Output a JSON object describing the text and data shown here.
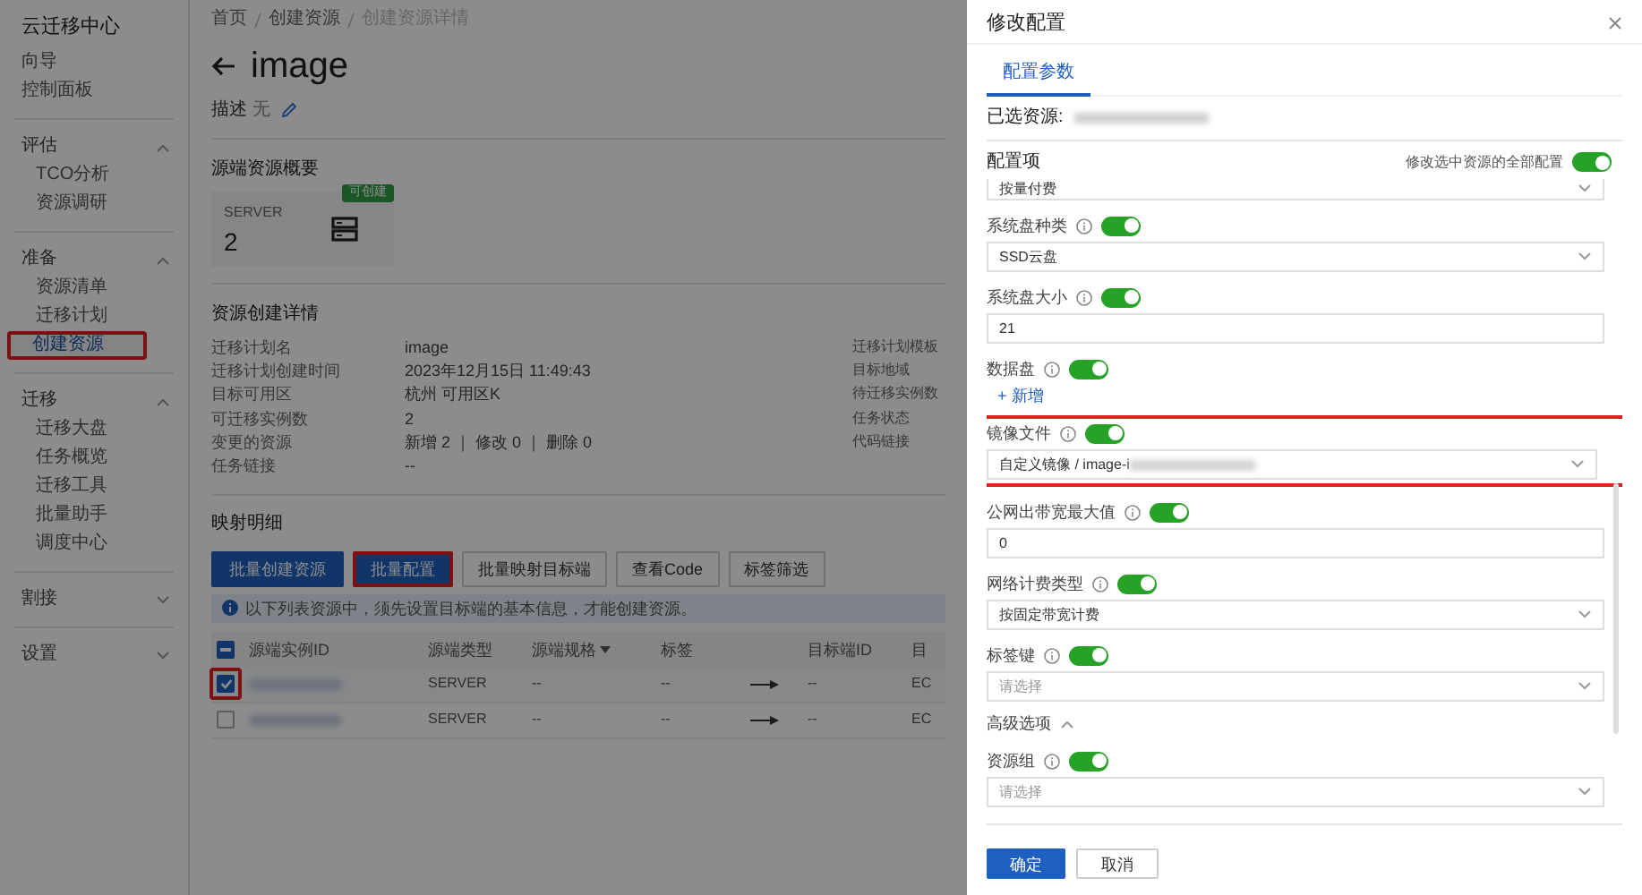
{
  "sidebar": {
    "title": "云迁移中心",
    "groups": [
      {
        "kind": "links",
        "items": [
          {
            "label": "向导",
            "selected": false,
            "highlighted": false
          },
          {
            "label": "控制面板",
            "selected": false,
            "highlighted": false
          }
        ]
      },
      {
        "kind": "group",
        "label": "评估",
        "expanded": true,
        "items": [
          {
            "label": "TCO分析",
            "selected": false,
            "highlighted": false
          },
          {
            "label": "资源调研",
            "selected": false,
            "highlighted": false
          }
        ]
      },
      {
        "kind": "group",
        "label": "准备",
        "expanded": true,
        "items": [
          {
            "label": "资源清单",
            "selected": false,
            "highlighted": false
          },
          {
            "label": "迁移计划",
            "selected": false,
            "highlighted": false
          },
          {
            "label": "创建资源",
            "selected": true,
            "highlighted": true
          }
        ]
      },
      {
        "kind": "group",
        "label": "迁移",
        "expanded": true,
        "items": [
          {
            "label": "迁移大盘",
            "selected": false,
            "highlighted": false
          },
          {
            "label": "任务概览",
            "selected": false,
            "highlighted": false
          },
          {
            "label": "迁移工具",
            "selected": false,
            "highlighted": false
          },
          {
            "label": "批量助手",
            "selected": false,
            "highlighted": false
          },
          {
            "label": "调度中心",
            "selected": false,
            "highlighted": false
          }
        ]
      },
      {
        "kind": "group",
        "label": "割接",
        "expanded": false
      },
      {
        "kind": "group",
        "label": "设置",
        "expanded": false
      }
    ]
  },
  "breadcrumb": [
    "首页",
    "创建资源",
    "创建资源详情"
  ],
  "page": {
    "title": "image",
    "description_label": "描述",
    "description_value": "无"
  },
  "overview": {
    "heading": "源端资源概要",
    "card": {
      "type": "SERVER",
      "count": "2",
      "badge": "可创建"
    }
  },
  "details": {
    "heading": "资源创建详情",
    "rows": [
      {
        "label": "迁移计划名",
        "value": "image",
        "right_label": "迁移计划模板"
      },
      {
        "label": "迁移计划创建时间",
        "value": "2023年12月15日 11:49:43",
        "right_label": "目标地域"
      },
      {
        "label": "目标可用区",
        "value": "杭州 可用区K",
        "right_label": "待迁移实例数"
      },
      {
        "label": "可迁移实例数",
        "value": "2",
        "right_label": "任务状态"
      },
      {
        "label": "变更的资源",
        "value": "新增 2 ｜ 修改 0 ｜ 删除 0",
        "right_label": "代码链接"
      },
      {
        "label": "任务链接",
        "value": "--"
      }
    ]
  },
  "mapping": {
    "heading": "映射明细",
    "buttons": [
      {
        "label": "批量创建资源",
        "primary": true,
        "highlighted": false
      },
      {
        "label": "批量配置",
        "primary": true,
        "highlighted": true
      },
      {
        "label": "批量映射目标端",
        "primary": false,
        "highlighted": false
      },
      {
        "label": "查看Code",
        "primary": false,
        "highlighted": false
      },
      {
        "label": "标签筛选",
        "primary": false,
        "highlighted": false
      }
    ],
    "notice": "以下列表资源中，须先设置目标端的基本信息，才能创建资源。",
    "table": {
      "header_partial": true,
      "columns": [
        {
          "label": "源端实例ID",
          "sortable": false
        },
        {
          "label": "源端类型",
          "sortable": false
        },
        {
          "label": "源端规格",
          "sortable": true
        },
        {
          "label": "标签",
          "sortable": false
        },
        {
          "label": "目标端ID",
          "sortable": false
        },
        {
          "label": "目",
          "sortable": false
        }
      ],
      "rows": [
        {
          "checked": true,
          "highlighted": true,
          "cells": [
            "",
            "SERVER",
            "--",
            "--",
            "--",
            "EC"
          ]
        },
        {
          "checked": false,
          "highlighted": false,
          "cells": [
            "",
            "SERVER",
            "--",
            "--",
            "--",
            "EC"
          ]
        }
      ]
    }
  },
  "drawer": {
    "title": "修改配置",
    "tabs": [
      {
        "label": "配置参数",
        "selected": true
      }
    ],
    "selected_label": "已选资源:",
    "config_label": "配置项",
    "apply_all": {
      "label": "修改选中资源的全部配置",
      "on": true
    },
    "fields": [
      {
        "kind": "partial",
        "value": "按量付费"
      },
      {
        "kind": "select",
        "label": "系统盘种类",
        "on": true,
        "value": "SSD云盘",
        "highlighted": false
      },
      {
        "kind": "input",
        "label": "系统盘大小",
        "on": true,
        "value": "21",
        "highlighted": false
      },
      {
        "kind": "add",
        "label": "数据盘",
        "on": true,
        "action": "+ 新增",
        "highlighted": false
      },
      {
        "kind": "select",
        "label": "镜像文件",
        "on": true,
        "value": "自定义镜像 / image-i",
        "highlighted": true
      },
      {
        "kind": "input",
        "label": "公网出带宽最大值",
        "on": true,
        "value": "0",
        "highlighted": false
      },
      {
        "kind": "select",
        "label": "网络计费类型",
        "on": true,
        "value": "按固定带宽计费",
        "highlighted": false
      },
      {
        "kind": "select",
        "label": "标签键",
        "on": true,
        "placeholder": "请选择",
        "highlighted": false
      },
      {
        "kind": "section",
        "label": "高级选项",
        "expanded": true
      },
      {
        "kind": "select",
        "label": "资源组",
        "on": true,
        "placeholder": "请选择",
        "highlighted": false
      }
    ],
    "buttons": [
      {
        "label": "确定",
        "primary": true
      },
      {
        "label": "取消",
        "primary": false
      }
    ]
  }
}
